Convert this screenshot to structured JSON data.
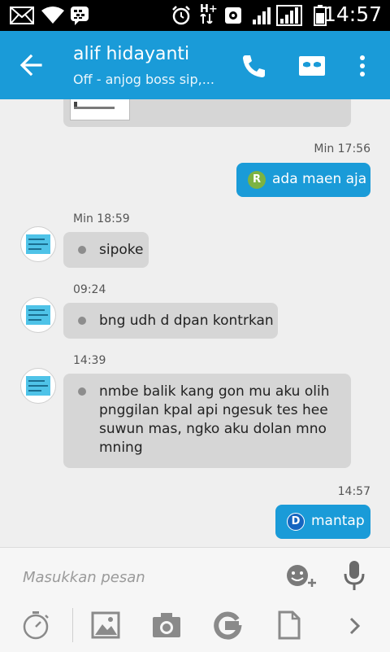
{
  "status_bar": {
    "time": "14:57",
    "network_label": "H+",
    "icons": [
      "mail-icon",
      "wifi-icon",
      "bbm-icon",
      "alarm-icon",
      "network-type-icon",
      "data-saver-icon",
      "signal-icon",
      "signal-icon-2",
      "battery-icon"
    ]
  },
  "header": {
    "contact_name": "alif hidayanti",
    "contact_status": "Off - anjog boss sip,...",
    "icons": [
      "back-arrow-icon",
      "phone-icon",
      "mask-icon",
      "more-vert-icon"
    ]
  },
  "messages": [
    {
      "direction": "out",
      "badge": "R",
      "badge_color": "#7cb342",
      "text": "ada maen aja",
      "time": "Min 17:56"
    },
    {
      "direction": "in",
      "text": "sipoke",
      "time": "Min 18:59"
    },
    {
      "direction": "in",
      "text": "bng udh d dpan kontrkan",
      "time": "09:24"
    },
    {
      "direction": "in",
      "text_lines": [
        "nmbe balik kang gon mu aku olih",
        "pnggilan kpal api ngesuk tes hee",
        "suwun mas, ngko aku dolan mno",
        "mning"
      ],
      "time": "14:39"
    },
    {
      "direction": "out",
      "badge": "D",
      "badge_color": "#1565c0",
      "text": "mantap",
      "time": "14:57"
    }
  ],
  "composer": {
    "placeholder": "Masukkan pesan",
    "icons": [
      "emoji-add-icon",
      "microphone-icon"
    ]
  },
  "toolbar": {
    "icons": [
      "timer-icon",
      "image-icon",
      "camera-icon",
      "google-icon",
      "document-icon",
      "chevron-right-icon"
    ]
  },
  "colors": {
    "accent": "#1a9bd8",
    "incoming_bubble": "#d6d6d6",
    "background": "#efefef"
  }
}
